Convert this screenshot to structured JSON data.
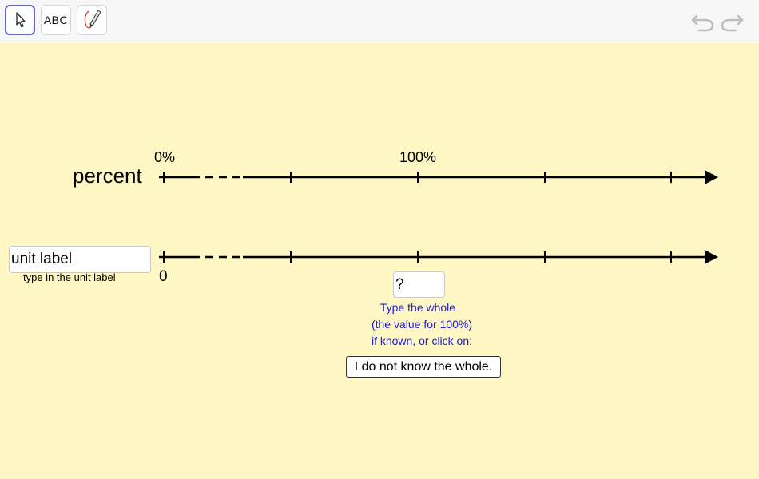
{
  "toolbar": {
    "tools": [
      {
        "name": "Move",
        "icon": "arrow-cursor-icon",
        "active": true
      },
      {
        "name": "Text",
        "icon": "abc-text-icon",
        "label": "ABC"
      },
      {
        "name": "Pen",
        "icon": "pen-icon"
      }
    ],
    "undo_icon": "undo-icon",
    "redo_icon": "redo-icon"
  },
  "percent_line": {
    "row_label": "percent",
    "tick_labels": {
      "zero": "0%",
      "hundred": "100%"
    }
  },
  "unit_line": {
    "unit_input_value": "unit label",
    "unit_input_hint": "type in the unit label",
    "zero_label": "0"
  },
  "whole": {
    "input_value": "?",
    "hint_lines": [
      "Type the whole",
      "(the value for 100%)",
      "if known, or click on:"
    ],
    "unknown_button_label": "I do not know the whole."
  },
  "colors": {
    "background": "#fff8c4",
    "hint_text": "#1b1bd9",
    "active_tool_border": "#6563c9"
  }
}
